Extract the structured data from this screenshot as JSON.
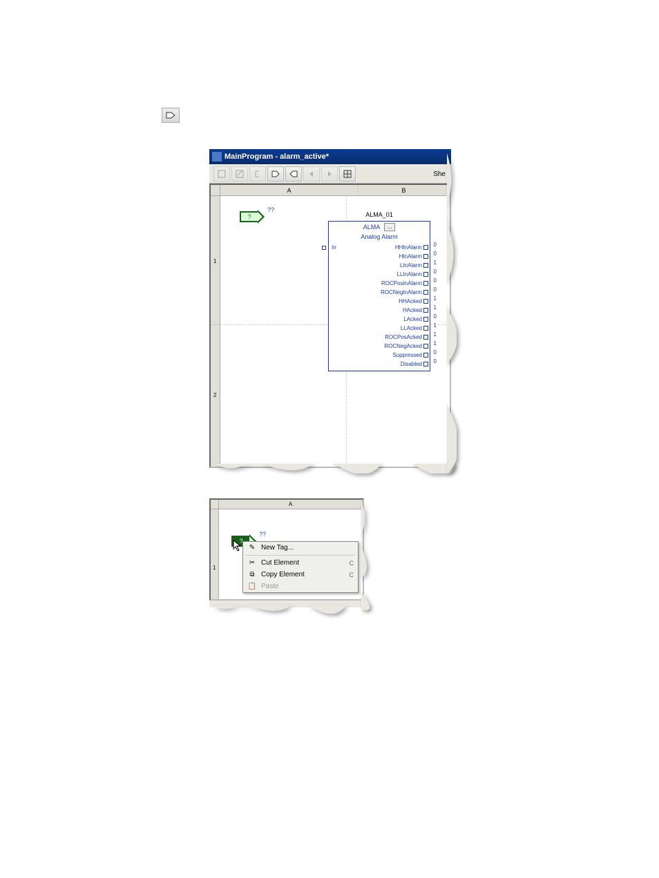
{
  "standalone_icon": "input-reference-icon",
  "window1": {
    "title": "MainProgram - alarm_active*",
    "cols": {
      "a": "A",
      "b": "B"
    },
    "rows": {
      "r1": "1",
      "r2": "2"
    },
    "iref": {
      "q": "?",
      "unbound": "??"
    },
    "block_tagname": "ALMA_01",
    "block": {
      "name": "ALMA",
      "subtitle": "Analog Alarm",
      "in_label": "In",
      "outputs": [
        {
          "label": "HHInAlarm",
          "val": "0"
        },
        {
          "label": "HInAlarm",
          "val": "0"
        },
        {
          "label": "LInAlarm",
          "val": "1"
        },
        {
          "label": "LLInAlarm",
          "val": "0"
        },
        {
          "label": "ROCPosInAlarm",
          "val": "0"
        },
        {
          "label": "ROCNegInAlarm",
          "val": "0"
        },
        {
          "label": "HHAcked",
          "val": "1"
        },
        {
          "label": "HAcked",
          "val": "1"
        },
        {
          "label": "LAcked",
          "val": "0"
        },
        {
          "label": "LLAcked",
          "val": "1"
        },
        {
          "label": "ROCPosAcked",
          "val": "1"
        },
        {
          "label": "ROCNegAcked",
          "val": "1"
        },
        {
          "label": "Suppressed",
          "val": "0"
        },
        {
          "label": "Disabled",
          "val": "0"
        }
      ]
    },
    "right_text": "She"
  },
  "window2": {
    "col_a": "A",
    "row1": "1",
    "iref": {
      "q": "?",
      "unbound": "??"
    },
    "context_menu": {
      "new_tag": "New Tag...",
      "cut": "Cut Element",
      "copy": "Copy Element",
      "paste": "Paste",
      "cut_short": "C",
      "copy_short": "C"
    }
  }
}
